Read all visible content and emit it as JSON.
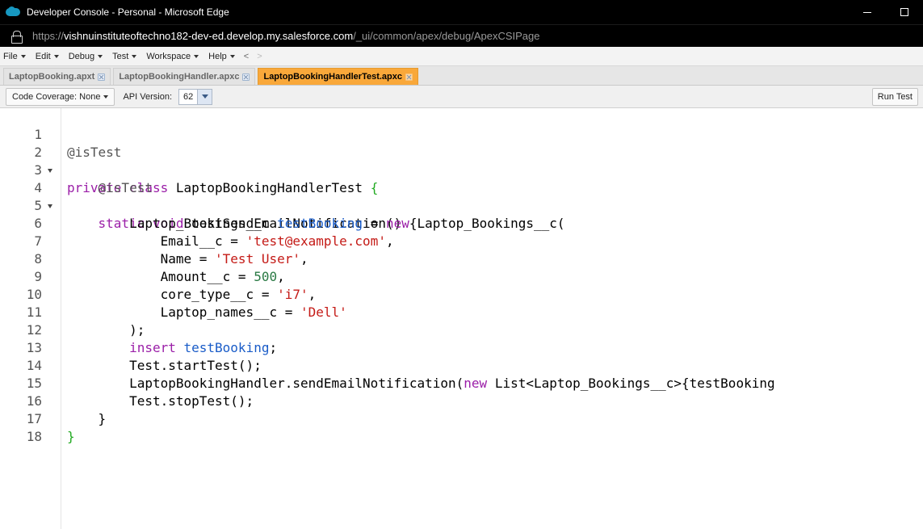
{
  "window": {
    "title": "Developer Console - Personal - Microsoft Edge"
  },
  "address": {
    "url_prefix": "https://",
    "url_host": "vishnuinstituteoftechno182-dev-ed.develop.my.salesforce.com",
    "url_path": "/_ui/common/apex/debug/ApexCSIPage"
  },
  "menu": {
    "file": "File",
    "edit": "Edit",
    "debug": "Debug",
    "test": "Test",
    "workspace": "Workspace",
    "help": "Help",
    "back": "<",
    "forward": ">"
  },
  "tabs": [
    {
      "label": "LaptopBooking.apxt",
      "active": false
    },
    {
      "label": "LaptopBookingHandler.apxc",
      "active": false
    },
    {
      "label": "LaptopBookingHandlerTest.apxc",
      "active": true
    }
  ],
  "toolbar": {
    "coverage": "Code Coverage: None",
    "api_label": "API Version:",
    "api_value": "62",
    "run_test": "Run Test"
  },
  "code": {
    "line_numbers": [
      "1",
      "2",
      "3",
      "4",
      "5",
      "6",
      "7",
      "8",
      "9",
      "10",
      "11",
      "12",
      "13",
      "14",
      "15",
      "16",
      "17",
      "18"
    ],
    "l1": {
      "a": "@isTest"
    },
    "l2": {
      "a": "private class",
      "b": " LaptopBookingHandlerTest ",
      "c": "{"
    },
    "l3": {
      "a": "    @isTest"
    },
    "l4": {
      "a": "    static void",
      "b": " testSendEmailNotification() {"
    },
    "l5": {
      "a": "        Laptop_Bookings__c ",
      "b": "testBooking",
      "c": " = ",
      "d": "new",
      "e": " Laptop_Bookings__c("
    },
    "l6": {
      "a": "            Email__c = ",
      "b": "'test@example.com'",
      "c": ","
    },
    "l7": {
      "a": "            Name = ",
      "b": "'Test User'",
      "c": ","
    },
    "l8": {
      "a": "            Amount__c = ",
      "b": "500",
      "c": ","
    },
    "l9": {
      "a": "            core_type__c = ",
      "b": "'i7'",
      "c": ","
    },
    "l10": {
      "a": "            Laptop_names__c = ",
      "b": "'Dell'"
    },
    "l11": {
      "a": "        );"
    },
    "l12": {
      "a": "        insert",
      "b": " testBooking",
      "c": ";"
    },
    "l13": {
      "a": "        Test.startTest();"
    },
    "l14": {
      "a": "        LaptopBookingHandler.sendEmailNotification(",
      "b": "new",
      "c": " List<Laptop_Bookings__c>{testBooking"
    },
    "l15": {
      "a": "        Test.stopTest();"
    },
    "l16": {
      "a": "    }"
    },
    "l17": {
      "a": "}"
    }
  }
}
